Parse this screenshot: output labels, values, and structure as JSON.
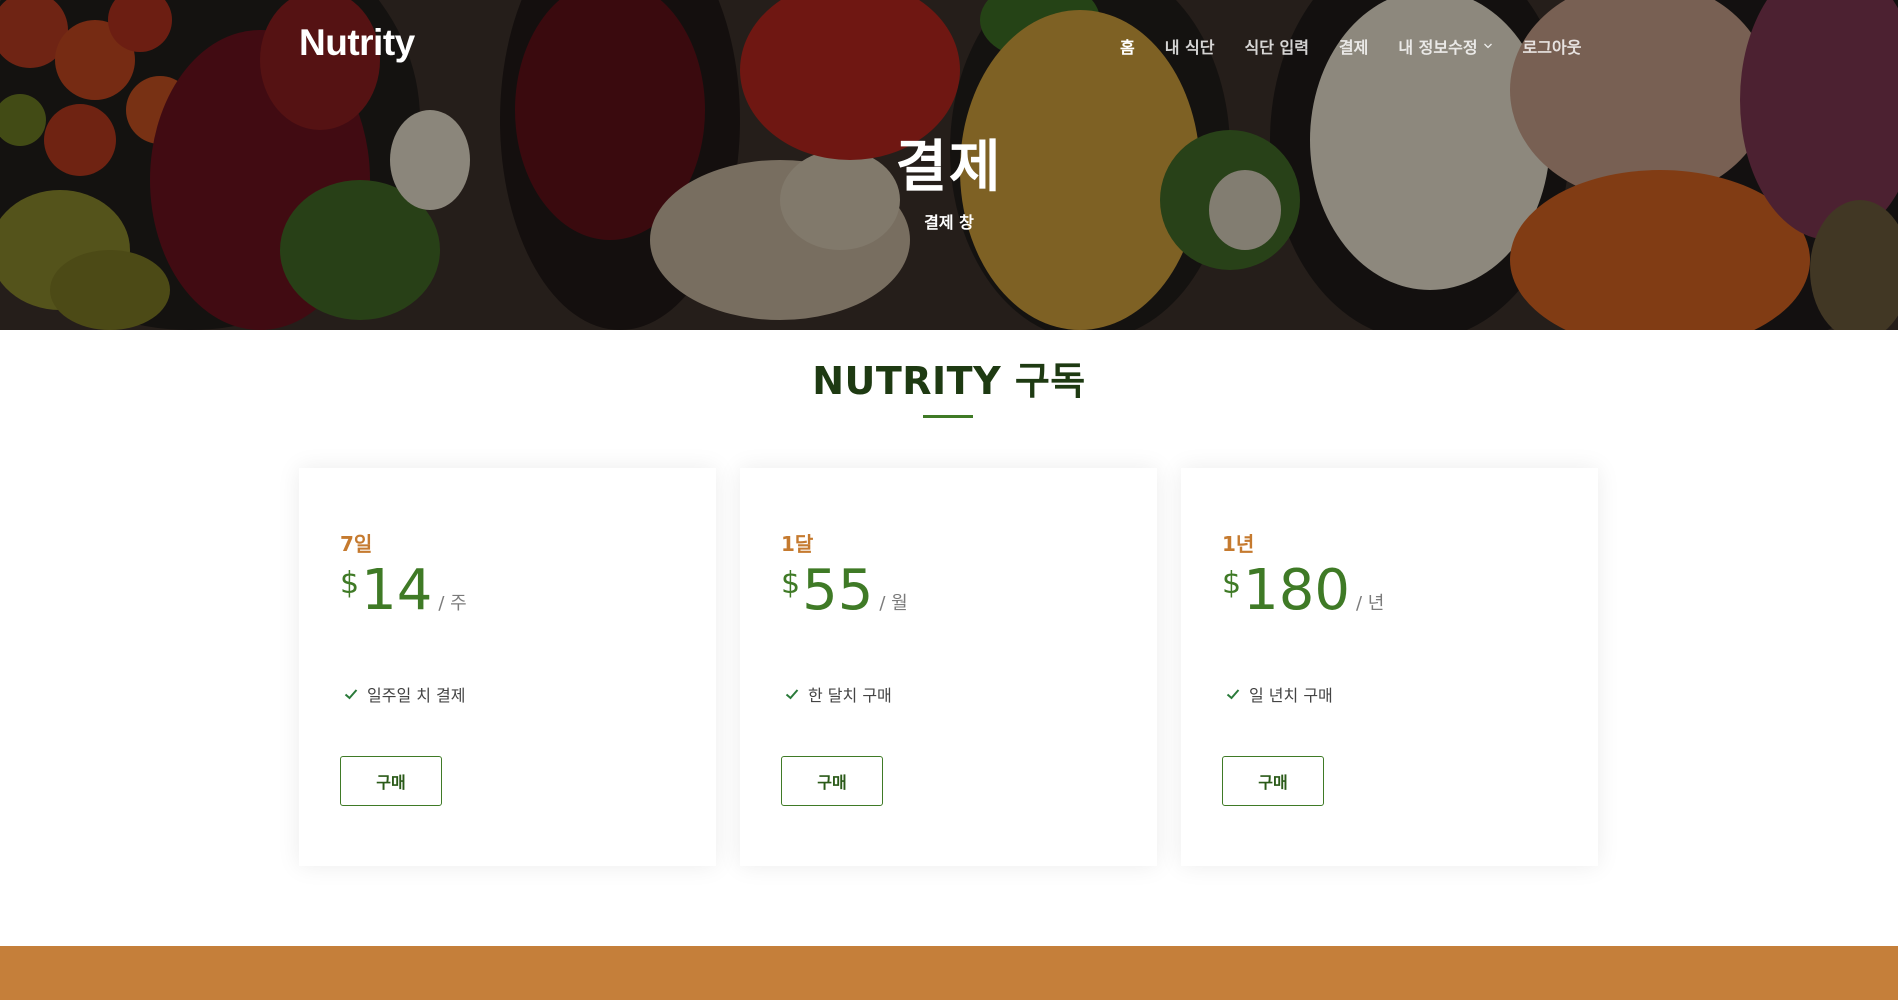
{
  "brand": {
    "logo": "Nutrity"
  },
  "nav": {
    "items": [
      {
        "label": "홈",
        "active": true
      },
      {
        "label": "내 식단",
        "active": false
      },
      {
        "label": "식단 입력",
        "active": false
      },
      {
        "label": "결제",
        "active": false
      },
      {
        "label": "내 정보수정",
        "active": false,
        "has_dropdown": true
      },
      {
        "label": "로그아웃",
        "active": false
      }
    ]
  },
  "hero": {
    "title": "결제",
    "subtitle": "결제 창"
  },
  "section": {
    "title": "NUTRITY 구독"
  },
  "plans": [
    {
      "period": "7일",
      "currency": "$",
      "amount": "14",
      "unit": "/ 주",
      "feature": "일주일 치 결제",
      "button": "구매"
    },
    {
      "period": "1달",
      "currency": "$",
      "amount": "55",
      "unit": "/ 월",
      "feature": "한 달치 구매",
      "button": "구매"
    },
    {
      "period": "1년",
      "currency": "$",
      "amount": "180",
      "unit": "/ 년",
      "feature": "일 년치 구매",
      "button": "구매"
    }
  ],
  "colors": {
    "accent_green": "#3f7a26",
    "title_green": "#1e3a12",
    "accent_orange": "#c57a2f",
    "footer_band": "#c57f3a"
  },
  "icons": {
    "feature": "check-icon",
    "dropdown": "chevron-down-icon"
  }
}
